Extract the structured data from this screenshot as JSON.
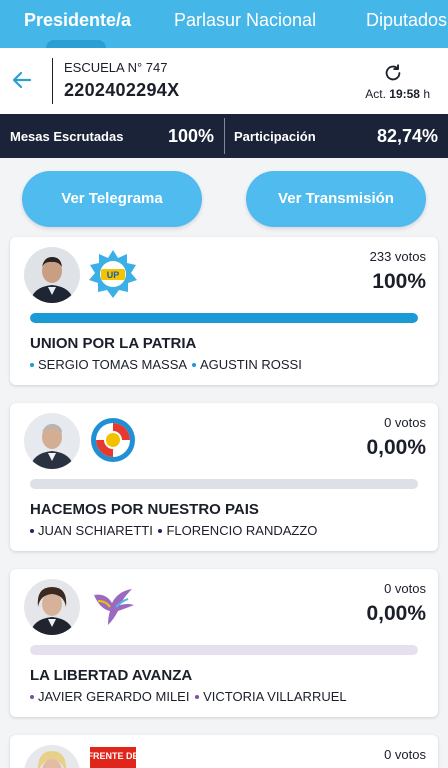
{
  "tabs": [
    {
      "label": "Presidente/a",
      "active": true
    },
    {
      "label": "Parlasur Nacional",
      "active": false
    },
    {
      "label": "Diputados",
      "active": false
    }
  ],
  "header": {
    "back_icon": "arrow-left-icon",
    "school": "ESCUELA N° 747",
    "mesa_code": "2202402294X",
    "refresh_icon": "refresh-icon",
    "updated_prefix": "Act.",
    "updated_time": "19:58",
    "updated_suffix": "h"
  },
  "stats": {
    "mesas_label": "Mesas Escrutadas",
    "mesas_value": "100%",
    "participacion_label": "Participación",
    "participacion_value": "82,74%"
  },
  "buttons": {
    "telegrama": "Ver Telegrama",
    "transmision": "Ver Transmisión"
  },
  "results": [
    {
      "party": "UNION POR LA PATRIA",
      "candidates": [
        "SERGIO TOMAS MASSA",
        "AGUSTIN ROSSI"
      ],
      "votes": "233 votos",
      "percent": "100%",
      "share": 1.0,
      "color": "#1a9ad6",
      "logo_icon": "up-party-logo-icon",
      "logo_text": "UP"
    },
    {
      "party": "HACEMOS POR NUESTRO PAIS",
      "candidates": [
        "JUAN SCHIARETTI",
        "FLORENCIO RANDAZZO"
      ],
      "votes": "0 votos",
      "percent": "0,00%",
      "share": 0.0,
      "color": "#1b2a5e",
      "logo_icon": "hacemos-party-logo-icon"
    },
    {
      "party": "LA LIBERTAD AVANZA",
      "candidates": [
        "JAVIER GERARDO MILEI",
        "VICTORIA VILLARRUEL"
      ],
      "votes": "0 votos",
      "percent": "0,00%",
      "share": 0.0,
      "color": "#7b4fa3",
      "logo_icon": "lla-party-logo-icon"
    },
    {
      "votes": "0 votos",
      "logo_icon": "frente-party-logo-icon",
      "logo_text": "FRENTE DE"
    }
  ],
  "colors": {
    "tab_bar": "#45b6e8",
    "stats_bar": "#1a2338",
    "button": "#4fbbee",
    "bar_track": "#dde0e6"
  }
}
